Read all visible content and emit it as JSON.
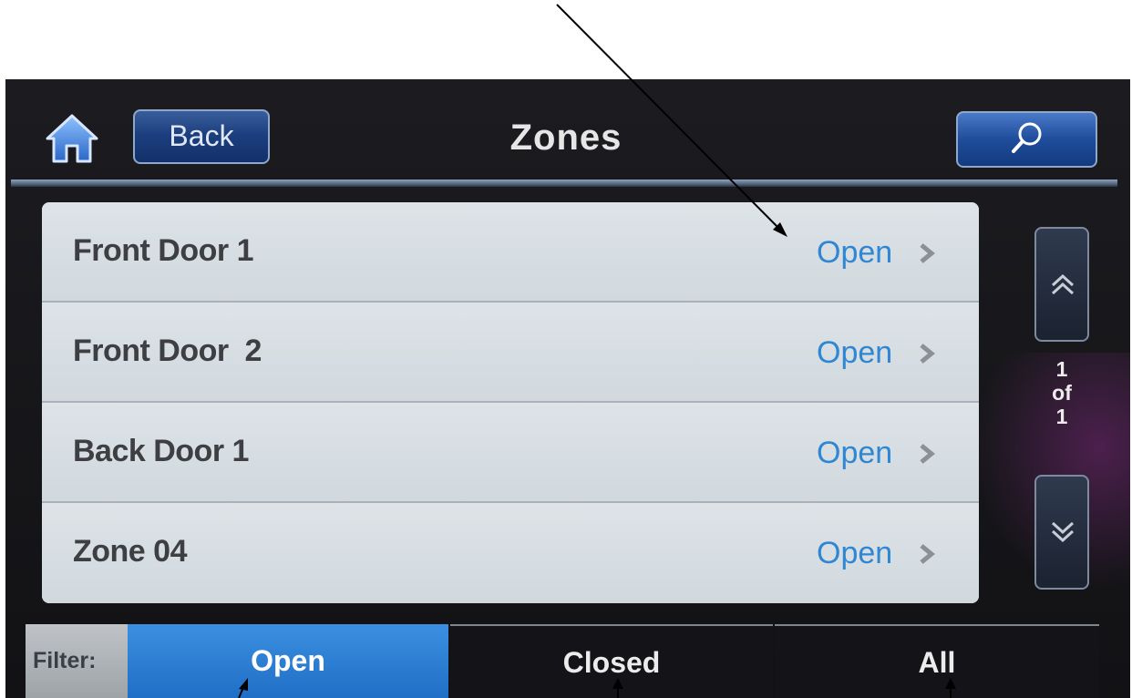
{
  "header": {
    "home_icon": "home-icon",
    "back_label": "Back",
    "title": "Zones",
    "search_icon": "search-icon"
  },
  "zones": [
    {
      "name": "Front Door 1",
      "status": "Open"
    },
    {
      "name": "Front Door  2",
      "status": "Open"
    },
    {
      "name": "Back Door 1",
      "status": "Open"
    },
    {
      "name": "Zone 04",
      "status": "Open"
    }
  ],
  "pagination": {
    "current": "1",
    "of_label": "of",
    "total": "1"
  },
  "filter": {
    "label": "Filter:",
    "tabs": [
      "Open",
      "Closed",
      "All"
    ],
    "selected": "Open"
  },
  "colors": {
    "status_text": "#2f86d2",
    "selected_tab": "#2a7fd6",
    "button_blue": "#1d3f7f",
    "list_bg": "#d6dde2"
  }
}
